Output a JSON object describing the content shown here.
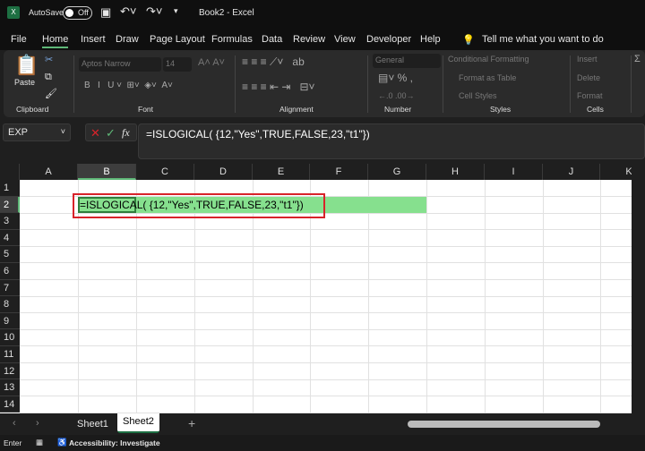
{
  "titlebar": {
    "autosave_label": "AutoSave",
    "autosave_state": "Off",
    "title": "Book2  -  Excel"
  },
  "menu": [
    "File",
    "Home",
    "Insert",
    "Draw",
    "Page Layout",
    "Formulas",
    "Data",
    "Review",
    "View",
    "Developer",
    "Help"
  ],
  "tell_me": "Tell me what you want to do",
  "ribbon": {
    "paste": "Paste",
    "font_name": "Aptos Narrow",
    "font_size": "14",
    "number_format": "General",
    "conditional_formatting": "Conditional Formatting",
    "format_as_table": "Format as Table",
    "cell_styles": "Cell Styles",
    "insert": "Insert",
    "delete": "Delete",
    "format": "Format",
    "groups": {
      "clipboard": "Clipboard",
      "font": "Font",
      "alignment": "Alignment",
      "number": "Number",
      "styles": "Styles",
      "cells": "Cells"
    }
  },
  "formula_bar": {
    "name_box": "EXP",
    "fx": "fx",
    "formula": "=ISLOGICAL( {12,\"Yes\",TRUE,FALSE,23,\"t1\"})"
  },
  "grid": {
    "columns": [
      "A",
      "B",
      "C",
      "D",
      "E",
      "F",
      "G",
      "H",
      "I",
      "J",
      "K"
    ],
    "rows": [
      "1",
      "2",
      "3",
      "4",
      "5",
      "6",
      "7",
      "8",
      "9",
      "10",
      "11",
      "12",
      "13",
      "14"
    ],
    "selected_cell": "B2",
    "cell_edit_text": "=ISLOGICAL( {12,\"Yes\",TRUE,FALSE,23,\"t1\"})",
    "highlight_color": "#86e08e",
    "annotation_color": "#d8232a"
  },
  "sheets": [
    {
      "name": "Sheet1",
      "active": false
    },
    {
      "name": "Sheet2",
      "active": true
    }
  ],
  "status": {
    "mode": "Enter",
    "accessibility": "Accessibility: Investigate"
  }
}
